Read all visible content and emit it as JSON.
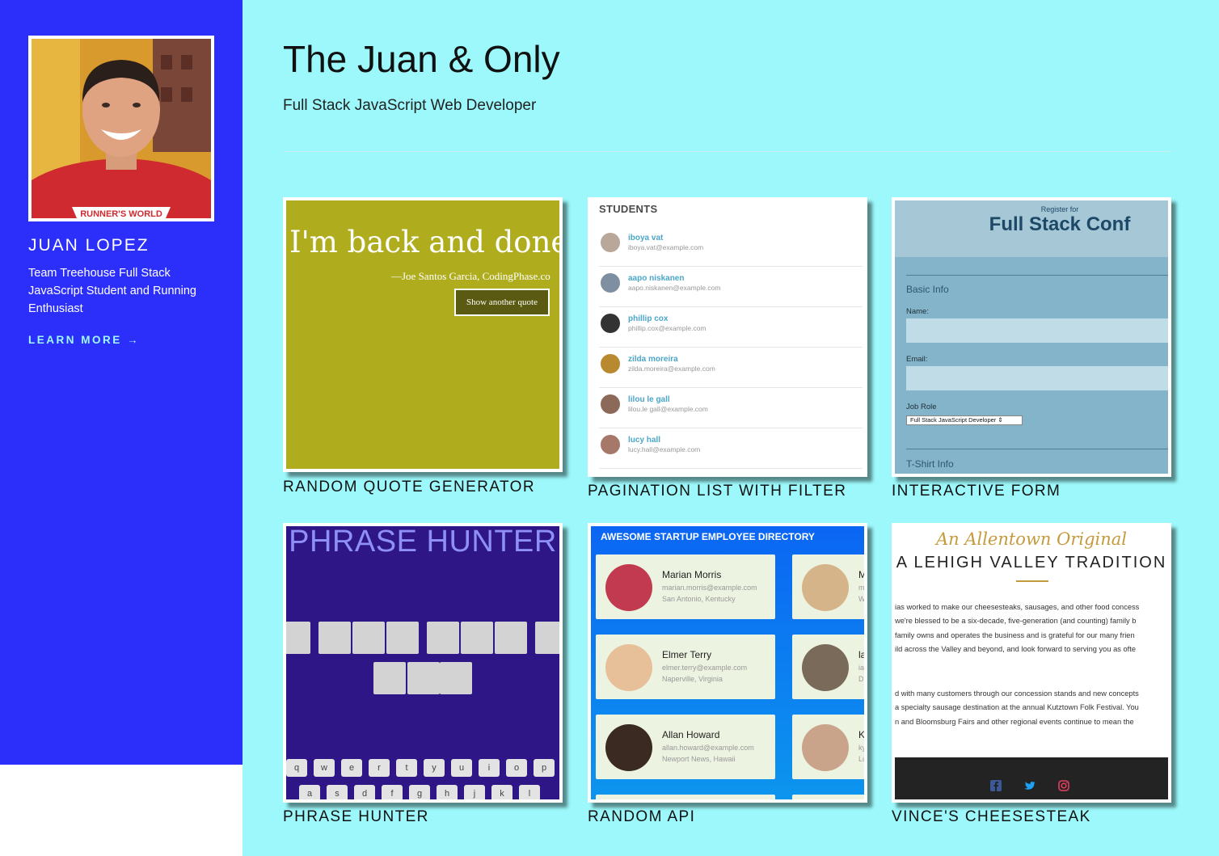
{
  "sidebar": {
    "name": "JUAN LOPEZ",
    "bio": "Team Treehouse Full Stack JavaScript Student and Running Enthusiast",
    "learn_more": "LEARN MORE →",
    "shirt_text": "RUNNER'S WORLD",
    "colors": {
      "background": "#2c2ffa",
      "link": "#9ff8fb"
    }
  },
  "header": {
    "title": "The Juan & Only",
    "subtitle": "Full Stack JavaScript Web Developer"
  },
  "projects": [
    {
      "label": "RANDOM QUOTE GENERATOR",
      "preview": {
        "quote": "I'm back and done c",
        "citation": "—Joe Santos Garcia, CodingPhase.co",
        "button": "Show another quote"
      }
    },
    {
      "label": "PAGINATION LIST WITH FILTER",
      "preview": {
        "heading": "STUDENTS",
        "students": [
          {
            "name": "iboya vat",
            "email": "iboya.vat@example.com"
          },
          {
            "name": "aapo niskanen",
            "email": "aapo.niskanen@example.com"
          },
          {
            "name": "phillip cox",
            "email": "phillip.cox@example.com"
          },
          {
            "name": "zilda moreira",
            "email": "zilda.moreira@example.com"
          },
          {
            "name": "lilou le gall",
            "email": "lilou.le gall@example.com"
          },
          {
            "name": "lucy hall",
            "email": "lucy.hall@example.com"
          }
        ]
      }
    },
    {
      "label": "INTERACTIVE FORM",
      "preview": {
        "register_for": "Register for",
        "conf_title": "Full Stack Conf",
        "basic_info": "Basic Info",
        "name_label": "Name:",
        "email_label": "Email:",
        "job_role_label": "Job Role",
        "job_role_value": "Full Stack JavaScript Developer",
        "tshirt_info": "T-Shirt Info"
      }
    },
    {
      "label": "PHRASE HUNTER",
      "preview": {
        "title": "PHRASE HUNTER",
        "keys_row1": [
          "q",
          "w",
          "e",
          "r",
          "t",
          "y",
          "u",
          "i",
          "o",
          "p"
        ],
        "keys_row2": [
          "a",
          "s",
          "d",
          "f",
          "g",
          "h",
          "j",
          "k",
          "l"
        ]
      }
    },
    {
      "label": "RANDOM API",
      "preview": {
        "heading": "AWESOME STARTUP EMPLOYEE DIRECTORY",
        "employees": [
          {
            "name": "Marian Morris",
            "email": "marian.morris@example.com",
            "location": "San Antonio, Kentucky"
          },
          {
            "name": "Elmer Terry",
            "email": "elmer.terry@example.com",
            "location": "Naperville, Virginia"
          },
          {
            "name": "Allan Howard",
            "email": "allan.howard@example.com",
            "location": "Newport News, Hawaii"
          }
        ],
        "partial": [
          {
            "name": "M",
            "email": "mi",
            "location": "W"
          },
          {
            "name": "la",
            "email": "ia",
            "location": "Di"
          },
          {
            "name": "Ky",
            "email": "ky",
            "location": "Lo"
          }
        ]
      }
    },
    {
      "label": "VINCE'S CHEESESTEAK",
      "preview": {
        "script_line": "An Allentown Original",
        "tagline": "A LEHIGH VALLEY TRADITION",
        "para1": [
          "ias worked to make our cheesesteaks, sausages, and other food concess",
          " we're blessed to be a six-decade, five-generation (and counting) family b",
          "family owns and operates the business and is grateful for our many frien",
          "ild across the Valley and beyond, and look forward to serving you as ofte"
        ],
        "para2": [
          "d with many customers through our concession stands and new concepts",
          "a specialty sausage destination at the annual Kutztown Folk Festival. You",
          "n and Bloomsburg Fairs and other regional events continue to mean the"
        ]
      }
    }
  ],
  "colors": {
    "main_background": "#9cf8fa"
  }
}
